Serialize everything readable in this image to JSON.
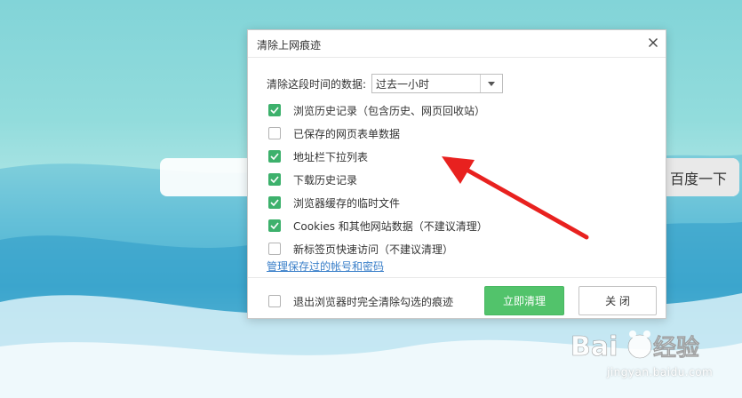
{
  "search": {
    "button_label": "百度一下"
  },
  "dialog": {
    "title": "清除上网痕迹",
    "range_label": "清除这段时间的数据:",
    "range_value": "过去一小时",
    "options": [
      {
        "label": "浏览历史记录（包含历史、网页回收站）",
        "checked": true
      },
      {
        "label": "已保存的网页表单数据",
        "checked": false
      },
      {
        "label": "地址栏下拉列表",
        "checked": true
      },
      {
        "label": "下载历史记录",
        "checked": true
      },
      {
        "label": "浏览器缓存的临时文件",
        "checked": true
      },
      {
        "label": "Cookies 和其他网站数据（不建议清理）",
        "checked": true
      },
      {
        "label": "新标签页快速访问（不建议清理）",
        "checked": false
      }
    ],
    "manage_link": "管理保存过的帐号和密码",
    "exit_clear_label": "退出浏览器时完全清除勾选的痕迹",
    "exit_clear_checked": false,
    "clear_button": "立即清理",
    "close_button": "关 闭"
  },
  "watermark": {
    "brand": "Baidu经验",
    "url": "jingyan.baidu.com"
  },
  "colors": {
    "accent_green": "#52c36b",
    "link_blue": "#3a7fc9",
    "arrow_red": "#e8211f"
  }
}
